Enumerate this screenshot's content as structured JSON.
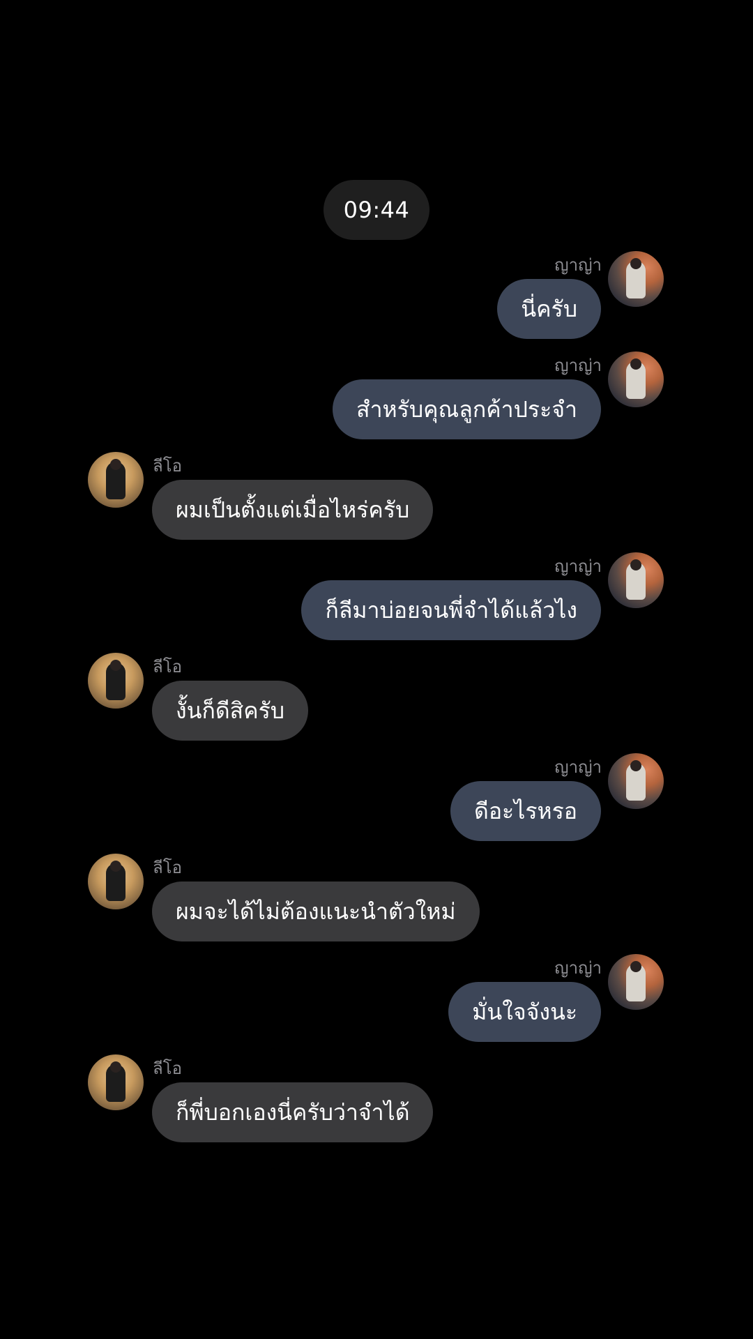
{
  "timestamp": "09:44",
  "messages": [
    {
      "dir": "out",
      "sender": "ญาญ่า",
      "text": "นี่ครับ"
    },
    {
      "dir": "out",
      "sender": "ญาญ่า",
      "text": "สำหรับคุณลูกค้าประจำ"
    },
    {
      "dir": "in",
      "sender": "ลีโอ",
      "text": "ผมเป็นตั้งแต่เมื่อไหร่ครับ"
    },
    {
      "dir": "out",
      "sender": "ญาญ่า",
      "text": "ก็ลีมาบ่อยจนพี่จำได้แล้วไง"
    },
    {
      "dir": "in",
      "sender": "ลีโอ",
      "text": "งั้นก็ดีสิครับ"
    },
    {
      "dir": "out",
      "sender": "ญาญ่า",
      "text": "ดีอะไรหรอ"
    },
    {
      "dir": "in",
      "sender": "ลีโอ",
      "text": "ผมจะได้ไม่ต้องแนะนำตัวใหม่"
    },
    {
      "dir": "out",
      "sender": "ญาญ่า",
      "text": "มั่นใจจังนะ"
    },
    {
      "dir": "in",
      "sender": "ลีโอ",
      "text": "ก็พี่บอกเองนี่ครับว่าจำได้"
    }
  ],
  "colors": {
    "background": "#000000",
    "outgoing_bubble": "#3d4658",
    "incoming_bubble": "#3a3a3c",
    "sender_name": "#8e8e93",
    "timestamp_pill": "#1f1f1f"
  }
}
